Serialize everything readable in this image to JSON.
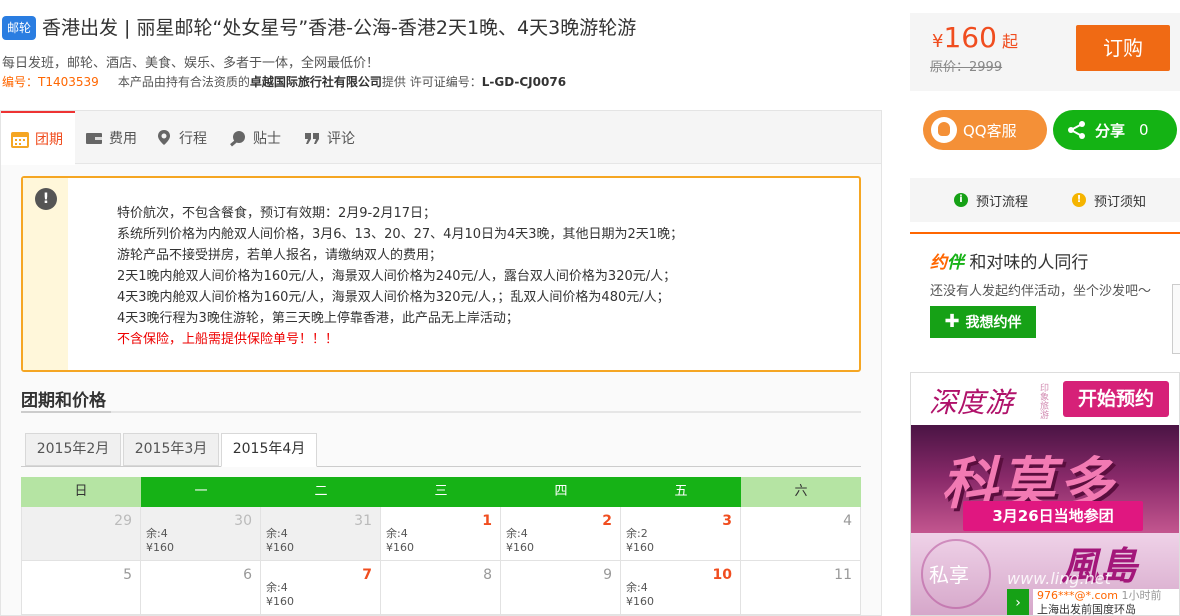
{
  "header": {
    "tag": "邮轮",
    "title": "香港出发 | 丽星邮轮“处女星号”香港-公海-香港2天1晚、4天3晚游轮游",
    "subtitle": "每日发班，邮轮、酒店、美食、娱乐、多者于一体，全网最低价！",
    "code_label": "编号：",
    "code": "T1403539",
    "provider_prefix": "本产品由持有合法资质的",
    "provider": "卓越国际旅行社有限公司",
    "provider_suffix": "提供 许可证编号：",
    "license": "L-GD-CJ0076"
  },
  "price": {
    "currency": "¥",
    "amount": "160",
    "from": "起",
    "original": "原价：2999",
    "buy_label": "订购"
  },
  "tabs": [
    {
      "label": "团期",
      "icon": "calendar-icon",
      "active": true
    },
    {
      "label": "费用",
      "icon": "wallet-icon"
    },
    {
      "label": "行程",
      "icon": "location-pin-icon"
    },
    {
      "label": "贴士",
      "icon": "search-icon"
    },
    {
      "label": "评论",
      "icon": "quote-icon"
    }
  ],
  "notice": {
    "lines": [
      "特价航次，不包含餐食，预订有效期：2月9-2月17日；",
      "系统所列价格为内舱双人间价格，3月6、13、20、27、4月10日为4天3晚，其他日期为2天1晚；",
      "游轮产品不接受拼房，若单人报名，请缴纳双人的费用；",
      "2天1晚内舱双人间价格为160元/人，海景双人间价格为240元/人，露台双人间价格为320元/人；",
      "4天3晚内舱双人间价格为160元/人，海景双人间价格为320元/人，；乱双人间价格为480元/人；",
      "4天3晚行程为3晚住游轮，第三天晚上停靠香港，此产品无上岸活动；"
    ],
    "warning": "不含保险，上船需提供保险单号！！！"
  },
  "section": {
    "title": "团期和价格"
  },
  "month_tabs": [
    {
      "label": "2015年2月"
    },
    {
      "label": "2015年3月"
    },
    {
      "label": "2015年4月",
      "active": true
    }
  ],
  "calendar": {
    "weekdays": [
      "日",
      "一",
      "二",
      "三",
      "四",
      "五",
      "六"
    ],
    "weeks": [
      [
        {
          "day": "29",
          "past": true
        },
        {
          "day": "30",
          "past": true,
          "remain": "余:4",
          "price": "¥160"
        },
        {
          "day": "31",
          "past": true,
          "remain": "余:4",
          "price": "¥160"
        },
        {
          "day": "1",
          "avail": true,
          "remain": "余:4",
          "price": "¥160"
        },
        {
          "day": "2",
          "avail": true,
          "remain": "余:4",
          "price": "¥160"
        },
        {
          "day": "3",
          "avail": true,
          "remain": "余:2",
          "price": "¥160"
        },
        {
          "day": "4"
        }
      ],
      [
        {
          "day": "5"
        },
        {
          "day": "6"
        },
        {
          "day": "7",
          "avail": true,
          "remain": "余:4",
          "price": "¥160"
        },
        {
          "day": "8"
        },
        {
          "day": "9"
        },
        {
          "day": "10",
          "avail": true,
          "remain": "余:4",
          "price": "¥160"
        },
        {
          "day": "11"
        }
      ]
    ]
  },
  "sidebar": {
    "qq_label": "QQ客服",
    "share_label": "分享",
    "share_count": "0",
    "flow": [
      {
        "label": "预订流程",
        "icon": "info-icon",
        "color": "#16a116",
        "glyph": "i"
      },
      {
        "label": "预订须知",
        "icon": "alert-icon",
        "color": "#f5b400",
        "glyph": "!"
      }
    ],
    "yueban": {
      "logo_a": "约",
      "logo_b": "伴",
      "title": "和对味的人同行",
      "tip": "还没有人发起约伴活动，坐个沙发吧～",
      "button": "我想约伴"
    },
    "ad": {
      "brand": "深度游",
      "brand_small": "印象旅游",
      "start": "开始预约",
      "big_text": "科莫多",
      "band": "3月26日当地参团",
      "sixiang": "私享",
      "big_purple": "風島",
      "watermark": "www.ling.net",
      "bubble_user": "976***@*.com",
      "bubble_time": "1小时前",
      "bubble_text": "上海出发前国度环岛"
    }
  },
  "colors": {
    "accent": "#f06a14",
    "green": "#16b216",
    "red": "#f04d1f"
  }
}
